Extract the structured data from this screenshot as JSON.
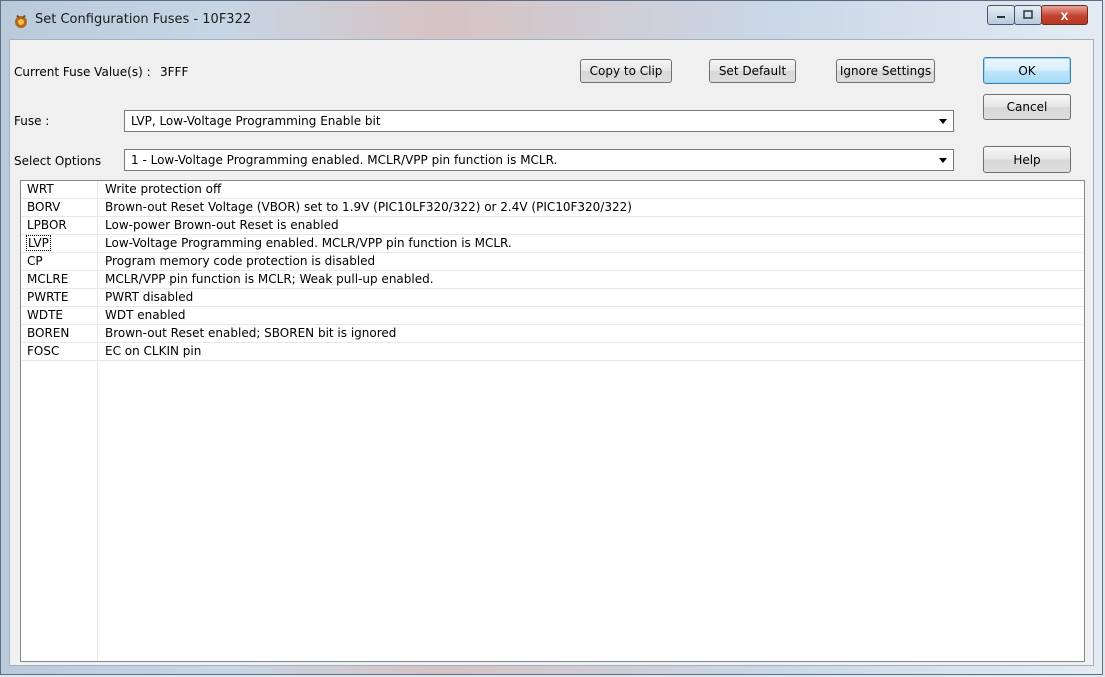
{
  "window": {
    "title": "Set Configuration Fuses - 10F322",
    "min_icon": "minimize-icon",
    "max_icon": "maximize-icon",
    "close_icon": "close-icon",
    "close_glyph": "x"
  },
  "current": {
    "label": "Current Fuse Value(s) :",
    "value": "3FFF"
  },
  "buttons": {
    "copy": "Copy to Clip",
    "default": "Set Default",
    "ignore": "Ignore Settings",
    "ok": "OK",
    "cancel": "Cancel",
    "help": "Help"
  },
  "fuse": {
    "label": "Fuse :",
    "selected": "LVP, Low-Voltage Programming Enable bit"
  },
  "options": {
    "label": "Select Options",
    "selected": "1 - Low-Voltage Programming enabled. MCLR/VPP pin function is MCLR."
  },
  "fuses": [
    {
      "name": "WRT",
      "desc": "Write protection off"
    },
    {
      "name": "BORV",
      "desc": "Brown-out Reset Voltage (VBOR) set to 1.9V (PIC10LF320/322) or 2.4V (PIC10F320/322)"
    },
    {
      "name": "LPBOR",
      "desc": "Low-power Brown-out Reset is enabled"
    },
    {
      "name": "LVP",
      "desc": "Low-Voltage Programming enabled. MCLR/VPP pin function is MCLR."
    },
    {
      "name": "CP",
      "desc": "Program memory code protection is disabled"
    },
    {
      "name": "MCLRE",
      "desc": "MCLR/VPP pin function is MCLR; Weak pull-up enabled."
    },
    {
      "name": "PWRTE",
      "desc": "PWRT disabled"
    },
    {
      "name": "WDTE",
      "desc": "WDT enabled"
    },
    {
      "name": "BOREN",
      "desc": "Brown-out Reset enabled; SBOREN bit is ignored"
    },
    {
      "name": "FOSC",
      "desc": "EC on CLKIN pin"
    }
  ],
  "focused_row": 3
}
